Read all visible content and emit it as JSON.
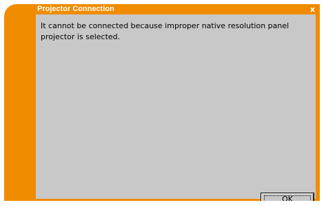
{
  "dialog": {
    "title": "Projector Connection",
    "close_glyph": "x",
    "message": "It cannot be connected because improper native resolution panel projector is selected.",
    "ok_label": "OK"
  },
  "colors": {
    "frame_orange": "#f08c00",
    "content_gray": "#c8c8c8",
    "title_text": "#ffffff"
  },
  "icons": {
    "close": "close-icon"
  }
}
